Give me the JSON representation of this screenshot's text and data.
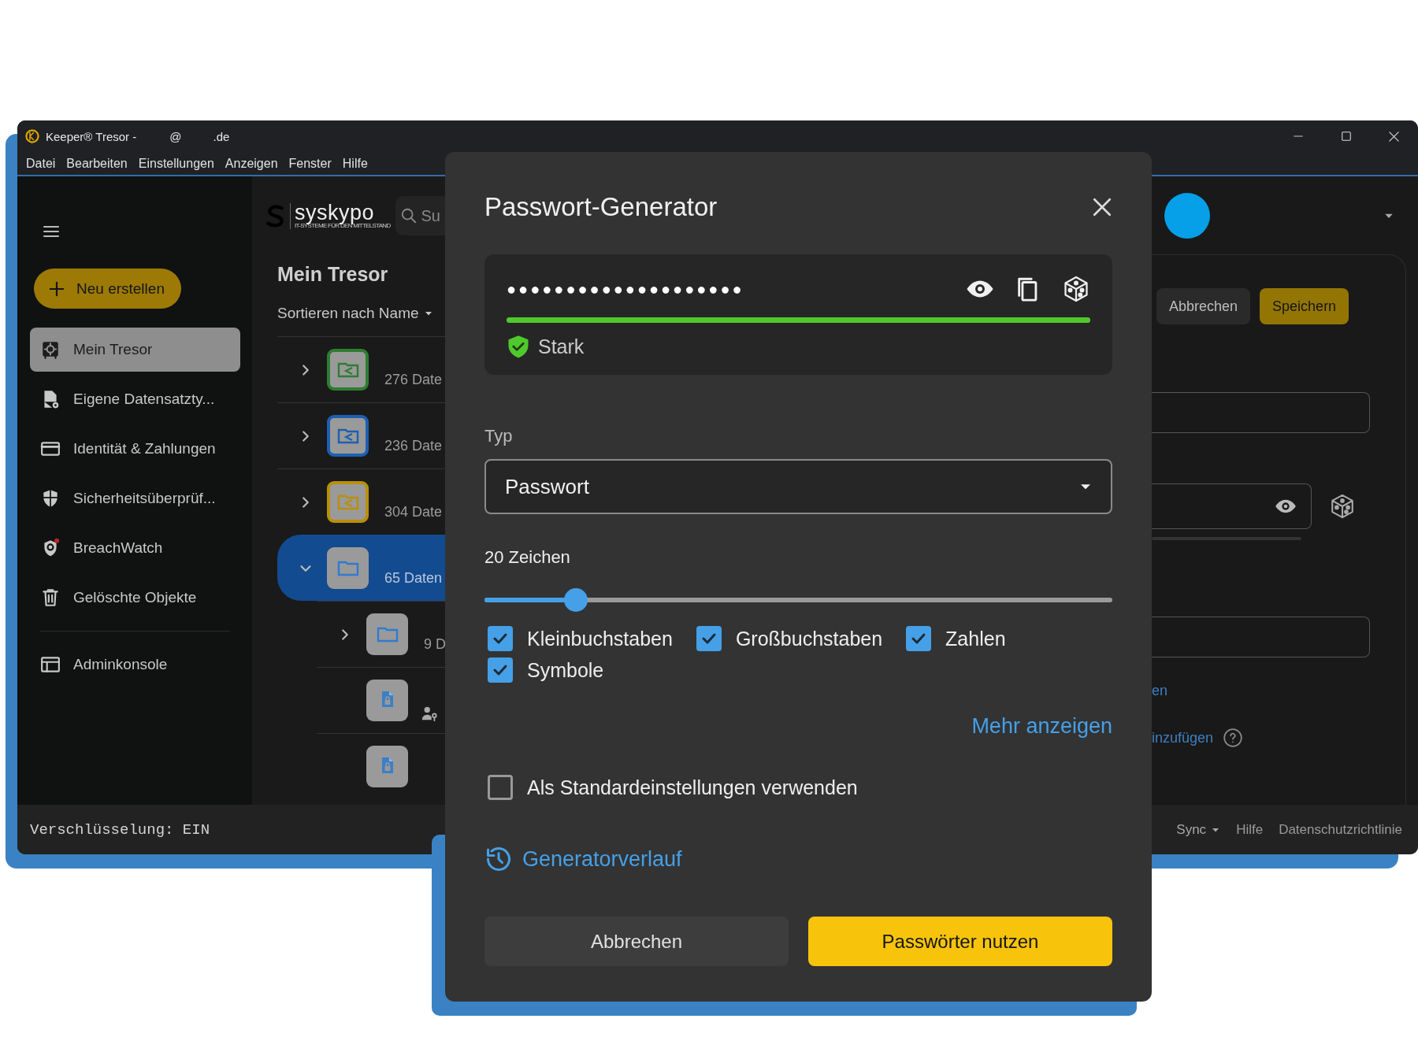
{
  "window": {
    "title_parts": [
      "Keeper® Tresor -",
      "@",
      ".de"
    ]
  },
  "menu": [
    "Datei",
    "Bearbeiten",
    "Einstellungen",
    "Anzeigen",
    "Fenster",
    "Hilfe"
  ],
  "sidebar": {
    "new_button": "Neu erstellen",
    "items": [
      {
        "label": "Mein Tresor",
        "selected": true
      },
      {
        "label": "Eigene Datensatzty...",
        "selected": false
      },
      {
        "label": "Identität & Zahlungen",
        "selected": false
      },
      {
        "label": "Sicherheitsüberprüf...",
        "selected": false
      },
      {
        "label": "BreachWatch",
        "selected": false
      },
      {
        "label": "Gelöschte Objekte",
        "selected": false
      }
    ],
    "footer_items": [
      {
        "label": "Adminkonsole",
        "selected": false
      }
    ]
  },
  "vault": {
    "logo": {
      "name": "syskypo",
      "tagline": "IT-SYSTEME FÜR DEN MITTELSTAND"
    },
    "search": {
      "placeholder": "Su"
    },
    "heading": "Mein Tresor",
    "sort": "Sortieren nach Name",
    "rows": [
      {
        "kind": "shared_folder",
        "count": "276 Date",
        "color": "#2e7d32",
        "expanded": false,
        "selected": false
      },
      {
        "kind": "shared_folder",
        "count": "236 Date",
        "color": "#1d5fb0",
        "expanded": false,
        "selected": false
      },
      {
        "kind": "shared_folder",
        "count": "304 Date",
        "color": "#b8900a",
        "expanded": false,
        "selected": false
      },
      {
        "kind": "folder",
        "count": "65 Daten",
        "expanded": true,
        "selected": true,
        "children": [
          {
            "kind": "folder",
            "count": "9 D",
            "expanded": false,
            "selected": false
          },
          {
            "kind": "shared_record",
            "selected": false
          },
          {
            "kind": "record",
            "selected": false
          }
        ]
      }
    ]
  },
  "record_panel": {
    "buttons": [
      {
        "label": "Abbrechen",
        "kind": "secondary"
      },
      {
        "label": "Speichern",
        "kind": "primary"
      }
    ],
    "links": [
      "en",
      "inzufügen"
    ]
  },
  "status_bar": {
    "encryption": "Verschlüsselung: EIN",
    "sync": "Sync",
    "help": "Hilfe",
    "privacy": "Datenschutzrichtlinie"
  },
  "dialog": {
    "title": "Passwort-Generator",
    "password_mask": "●●●●●●●●●●●●●●●●●●●●",
    "strength": {
      "level": 1,
      "label": "Stark"
    },
    "type_label": "Typ",
    "type_value": "Passwort",
    "length_label": "20 Zeichen",
    "length_slider": {
      "level": 0.145
    },
    "options": [
      {
        "label": "Kleinbuchstaben",
        "checked": true
      },
      {
        "label": "Großbuchstaben",
        "checked": true
      },
      {
        "label": "Zahlen",
        "checked": true
      },
      {
        "label": "Symbole",
        "checked": true
      }
    ],
    "more_link": "Mehr anzeigen",
    "default_option": {
      "label": "Als Standardeinstellungen verwenden",
      "checked": false
    },
    "history_link": "Generatorverlauf",
    "buttons": [
      {
        "label": "Abbrechen",
        "kind": "secondary"
      },
      {
        "label": "Passwörter nutzen",
        "kind": "primary"
      }
    ]
  }
}
